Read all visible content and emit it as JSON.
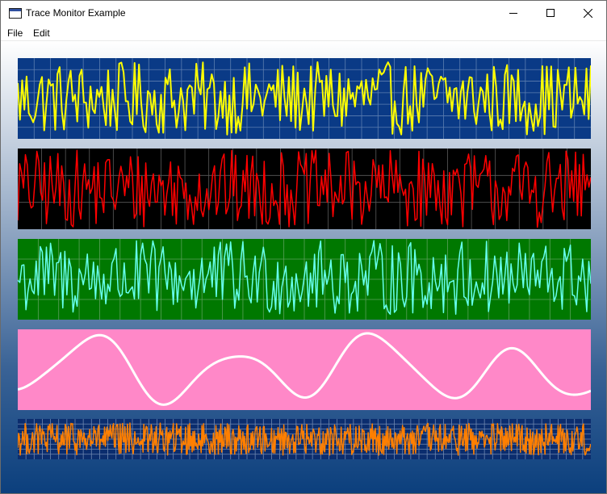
{
  "window": {
    "title": "Trace Monitor Example",
    "icon": "app-window-icon"
  },
  "caption_buttons": {
    "minimize": "minimize-icon",
    "maximize": "maximize-icon",
    "close": "close-icon"
  },
  "menu": {
    "items": [
      "File",
      "Edit"
    ]
  },
  "colors": {
    "client_gradient": [
      "#ffffff",
      "#9aaec8",
      "#3a6396",
      "#0b3f7d"
    ],
    "title_bar": "#ffffff"
  },
  "traces": [
    {
      "name": "trace-1",
      "background": "#0a3a86",
      "grid_color": "#5c7eb0",
      "line_color": "#ffff00",
      "line_width": 2,
      "waveform": "random-noise",
      "amplitude_range": [
        0.05,
        0.95
      ],
      "samples": 260,
      "grid_cols": 35,
      "grid_rows": 7
    },
    {
      "name": "trace-2",
      "background": "#000000",
      "grid_color": "#5a5a5a",
      "line_color": "#ff0000",
      "line_width": 1.5,
      "waveform": "random-noise",
      "amplitude_range": [
        0.02,
        0.98
      ],
      "samples": 300,
      "grid_cols": 24,
      "grid_rows": 3
    },
    {
      "name": "trace-3",
      "background": "#007800",
      "grid_color": "#5aa05a",
      "line_color": "#66ffee",
      "line_width": 1.5,
      "waveform": "random-noise",
      "amplitude_range": [
        0.05,
        0.98
      ],
      "samples": 280,
      "grid_cols": 28,
      "grid_rows": 4
    },
    {
      "name": "trace-4",
      "background": "#ff88c8",
      "grid_color": "none",
      "line_color": "#ffffff",
      "line_width": 3,
      "waveform": "smooth-sine-mix",
      "amplitude_range": [
        0.0,
        1.0
      ],
      "samples": 0,
      "grid_cols": 0,
      "grid_rows": 0
    },
    {
      "name": "trace-5",
      "background": "#0b2d6e",
      "grid_color": "#6f88b0",
      "line_color": "#ff7f00",
      "line_width": 1.5,
      "waveform": "random-noise",
      "amplitude_range": [
        0.1,
        0.9
      ],
      "samples": 700,
      "grid_cols": 70,
      "grid_rows": 8
    }
  ]
}
